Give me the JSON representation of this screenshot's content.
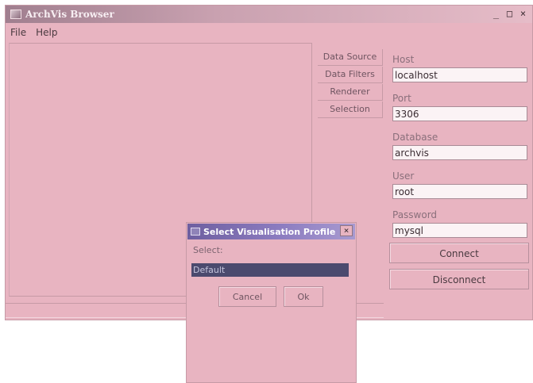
{
  "window": {
    "title": "ArchVis Browser",
    "controls": [
      "_",
      "□",
      "×"
    ]
  },
  "menu": [
    "File",
    "Help"
  ],
  "tabs": [
    "Data Source",
    "Data Filters",
    "Renderer",
    "Selection"
  ],
  "connection": {
    "host_label": "Host",
    "host_value": "localhost",
    "port_label": "Port",
    "port_value": "3306",
    "database_label": "Database",
    "database_value": "archvis",
    "user_label": "User",
    "user_value": "root",
    "password_label": "Password",
    "password_value": "mysql",
    "connect_label": "Connect",
    "disconnect_label": "Disconnect"
  },
  "dialog": {
    "title": "Select Visualisation Profile",
    "close": "×",
    "select_label": "Select:",
    "selected_option": "Default",
    "cancel_label": "Cancel",
    "ok_label": "Ok"
  },
  "colors": {
    "background": "#e8b4c1",
    "titlebar": "#a07f8f",
    "dialog_titlebar": "#6e5fa0",
    "selection": "#4b4a6e"
  },
  "icons": {
    "app": "window-icon",
    "dialog": "window-icon"
  }
}
